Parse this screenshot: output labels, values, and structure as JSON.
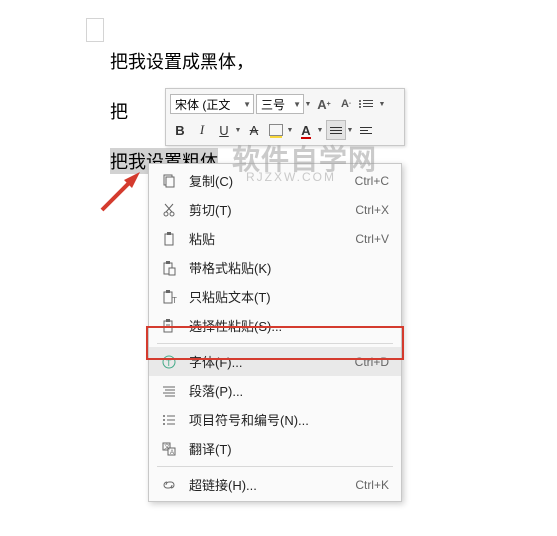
{
  "doc": {
    "line1": "把我设置成黑体，",
    "line2_prefix": "把",
    "line3_selected": "把我设置粗体",
    "line3_suffix": "。"
  },
  "toolbar": {
    "font_name": "宋体 (正文",
    "font_size": "三号",
    "increase_font": "A⁺",
    "decrease_font": "A⁻",
    "bold": "B",
    "italic": "I",
    "underline": "U",
    "strike": "A",
    "font_color_letter": "A"
  },
  "context_menu": {
    "items": [
      {
        "icon": "copy-icon",
        "label": "复制(C)",
        "shortcut": "Ctrl+C"
      },
      {
        "icon": "cut-icon",
        "label": "剪切(T)",
        "shortcut": "Ctrl+X"
      },
      {
        "icon": "paste-icon",
        "label": "粘贴",
        "shortcut": "Ctrl+V"
      },
      {
        "icon": "paste-fmt-icon",
        "label": "带格式粘贴(K)",
        "shortcut": ""
      },
      {
        "icon": "paste-text-icon",
        "label": "只粘贴文本(T)",
        "shortcut": ""
      },
      {
        "icon": "paste-sel-icon",
        "label": "选择性粘贴(S)...",
        "shortcut": ""
      },
      {
        "sep": true
      },
      {
        "icon": "font-icon",
        "label": "字体(F)...",
        "shortcut": "Ctrl+D",
        "hovered": true,
        "highlighted": true
      },
      {
        "icon": "paragraph-icon",
        "label": "段落(P)...",
        "shortcut": ""
      },
      {
        "icon": "bullets-icon",
        "label": "项目符号和编号(N)...",
        "shortcut": ""
      },
      {
        "icon": "translate-icon",
        "label": "翻译(T)",
        "shortcut": ""
      },
      {
        "sep": true
      },
      {
        "icon": "link-icon",
        "label": "超链接(H)...",
        "shortcut": "Ctrl+K"
      }
    ]
  },
  "watermark": {
    "main": "软件自学网",
    "sub": "RJZXW.COM"
  }
}
